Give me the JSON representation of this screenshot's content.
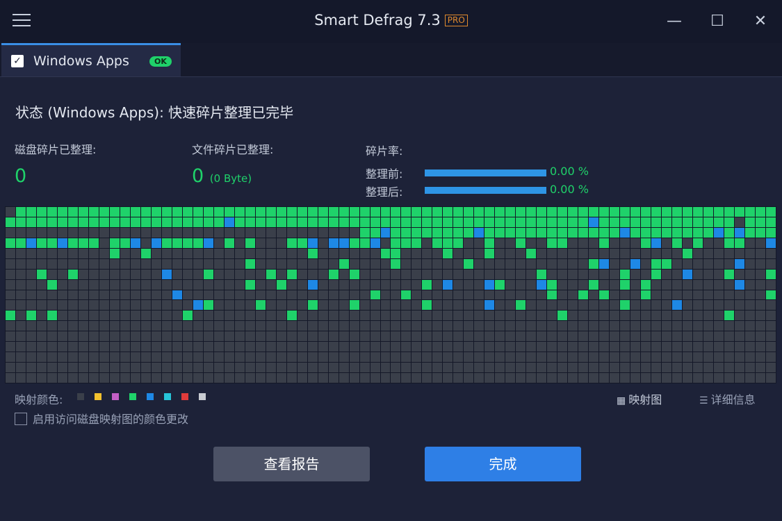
{
  "window": {
    "title": "Smart Defrag 7.3",
    "badge": "PRO",
    "minimize": "—",
    "maximize": "☐",
    "close": "✕"
  },
  "tab": {
    "label": "Windows Apps",
    "status": "OK"
  },
  "status_line": "状态 (Windows Apps): 快速碎片整理已完毕",
  "stats": {
    "disk_label": "磁盘碎片已整理:",
    "disk_value": "0",
    "file_label": "文件碎片已整理:",
    "file_value": "0",
    "file_sub": "(0 Byte)",
    "rate_label": "碎片率:",
    "before_label": "整理前:",
    "before_value": "0.00 %",
    "after_label": "整理后:",
    "after_value": "0.00 %"
  },
  "legend": {
    "label": "映射颜色:",
    "colors": [
      "#3a3f4a",
      "#f2c12e",
      "#c45fc6",
      "#1fd26a",
      "#1e88e5",
      "#27c4d8",
      "#e03b3b",
      "#c9ccd2"
    ]
  },
  "option": {
    "label": "启用访问磁盘映射图的颜色更改"
  },
  "views": {
    "map": "映射图",
    "details": "详细信息"
  },
  "buttons": {
    "report": "查看报告",
    "done": "完成"
  },
  "colors": {
    "used": "#1fd26a",
    "defragged": "#1e88e5",
    "free": "#3a3f4a",
    "accent": "#2e7fe6"
  }
}
